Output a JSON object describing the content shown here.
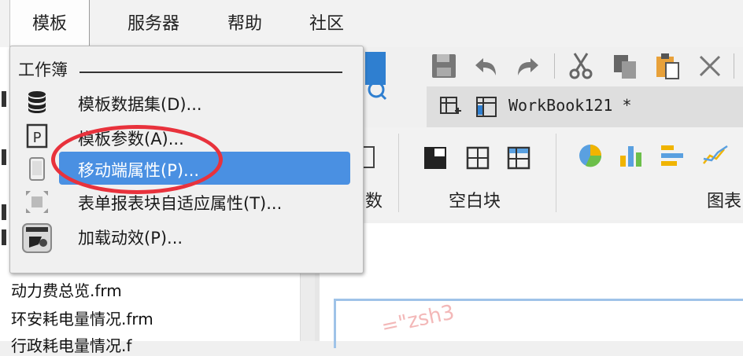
{
  "menubar": {
    "template": "模板",
    "server": "服务器",
    "help": "帮助",
    "community": "社区"
  },
  "dropdown": {
    "section_header": "工作簿",
    "items": [
      {
        "label": "模板数据集(D)...",
        "icon": "database-icon",
        "active": false
      },
      {
        "label": "模板参数(A)...",
        "icon": "parameter-icon",
        "active": false
      },
      {
        "label": "移动端属性(P)...",
        "icon": "mobile-icon",
        "active": true
      },
      {
        "label": "表单报表块自适应属性(T)...",
        "icon": "adaptive-icon",
        "active": false
      },
      {
        "label": "加载动效(P)...",
        "icon": "animation-icon",
        "active": false
      }
    ]
  },
  "files": [
    "动力费总览.frm",
    "环安耗电量情况.frm",
    "行政耗电量情况.f"
  ],
  "tab": {
    "title": "WorkBook121 *"
  },
  "ribbon": {
    "groups": [
      "数",
      "空白块",
      "图表"
    ]
  },
  "watermark": "=\"zsh3",
  "colors": {
    "highlight": "#4a90e2",
    "annotation": "#e8323c",
    "selection": "#9fc3e8"
  }
}
